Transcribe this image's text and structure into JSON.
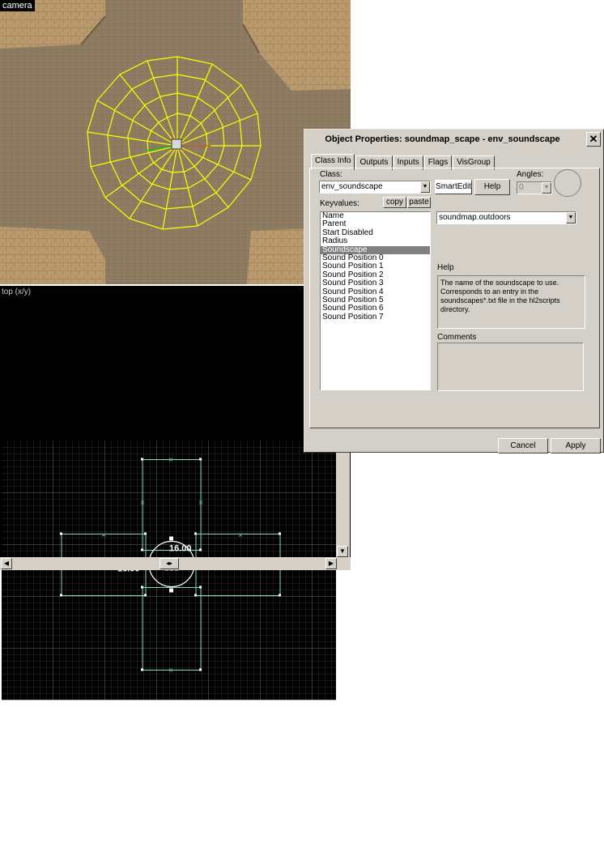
{
  "camera": {
    "label": "camera"
  },
  "top_view": {
    "label": "top (x/y)",
    "dimension_width": "16.00",
    "dimension_height": "16.00"
  },
  "dialog": {
    "title": "Object Properties: soundmap_scape - env_soundscape",
    "close_glyph": "✕",
    "tabs": [
      "Class Info",
      "Outputs",
      "Inputs",
      "Flags",
      "VisGroup"
    ],
    "class_label": "Class:",
    "class_value": "env_soundscape",
    "smartedit_label": "SmartEdit",
    "help_button_label": "Help",
    "angles_label": "Angles:",
    "angles_value": "0",
    "keyvalues_label": "Keyvalues:",
    "copy_label": "copy",
    "paste_label": "paste",
    "keyvalues": [
      "Name",
      "Parent",
      "Start Disabled",
      "Radius",
      "Soundscape",
      "Sound Position 0",
      "Sound Position 1",
      "Sound Position 2",
      "Sound Position 3",
      "Sound Position 4",
      "Sound Position 5",
      "Sound Position 6",
      "Sound Position 7"
    ],
    "selected_keyvalue": "Soundscape",
    "soundscape_value": "soundmap.outdoors",
    "help_label": "Help",
    "help_text": "The name of the soundscape to use. Corresponds to an entry in the soundscapes*.txt file in the hl2scripts directory.",
    "comments_label": "Comments",
    "cancel_label": "Cancel",
    "apply_label": "Apply"
  }
}
